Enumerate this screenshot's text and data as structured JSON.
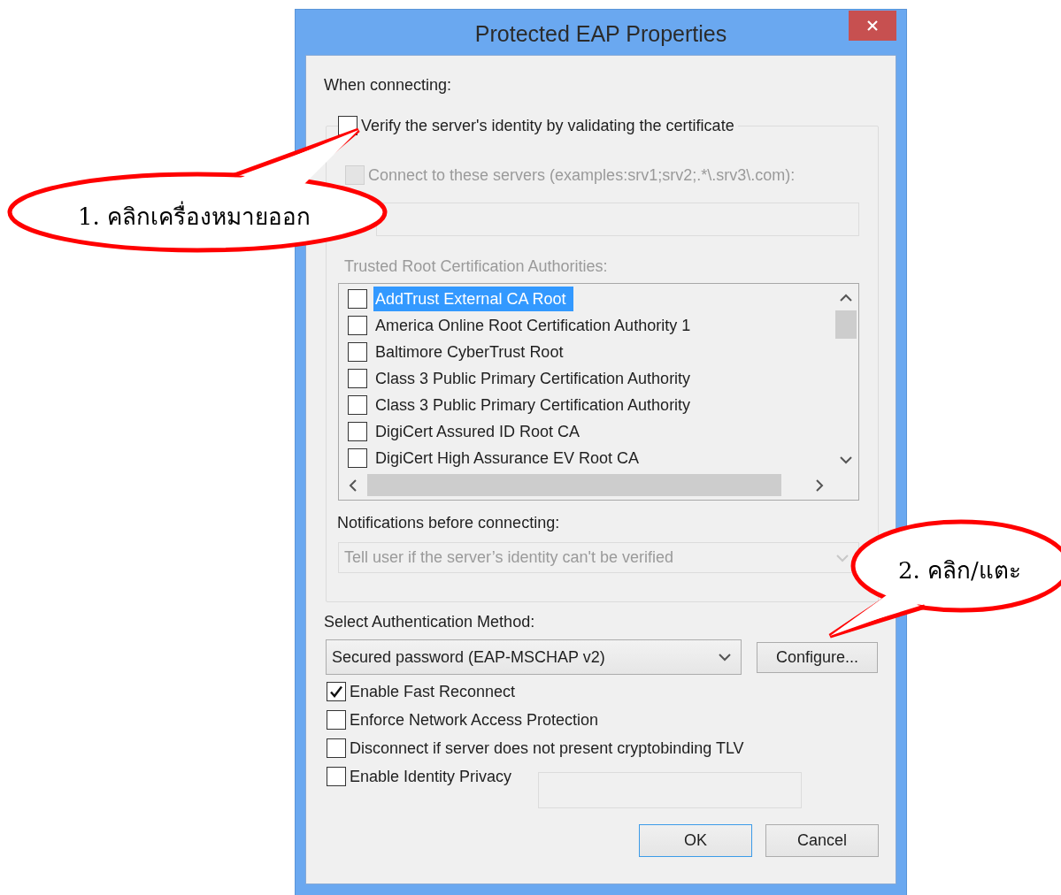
{
  "window": {
    "title": "Protected EAP Properties"
  },
  "when_connecting_label": "When connecting:",
  "verify_certificate": {
    "label": "Verify the server's identity by validating the certificate",
    "checked": false
  },
  "connect_servers": {
    "label": "Connect to these servers (examples:srv1;srv2;.*\\.srv3\\.com):",
    "checked": false,
    "disabled": true
  },
  "trusted_roots": {
    "label": "Trusted Root Certification Authorities:",
    "disabled": true,
    "items": [
      {
        "label": "AddTrust External CA Root",
        "checked": false,
        "selected": true
      },
      {
        "label": "America Online Root Certification Authority 1",
        "checked": false,
        "selected": false
      },
      {
        "label": "Baltimore CyberTrust Root",
        "checked": false,
        "selected": false
      },
      {
        "label": "Class 3 Public Primary Certification Authority",
        "checked": false,
        "selected": false
      },
      {
        "label": "Class 3 Public Primary Certification Authority",
        "checked": false,
        "selected": false
      },
      {
        "label": "DigiCert Assured ID Root CA",
        "checked": false,
        "selected": false
      },
      {
        "label": "DigiCert High Assurance EV Root CA",
        "checked": false,
        "selected": false
      }
    ]
  },
  "notifications": {
    "label": "Notifications before connecting:",
    "value": "Tell user if the server’s identity can't be verified",
    "disabled": true
  },
  "authentication": {
    "label": "Select Authentication Method:",
    "value": "Secured password (EAP-MSCHAP v2)",
    "configure_button": "Configure..."
  },
  "options": [
    {
      "kind": "checkbox",
      "label": "Enable Fast Reconnect",
      "checked": true
    },
    {
      "kind": "checkbox",
      "label": "Enforce Network Access Protection",
      "checked": false
    },
    {
      "kind": "checkbox",
      "label": "Disconnect if server does not present cryptobinding TLV",
      "checked": false
    },
    {
      "kind": "checkbox_field",
      "label": "Enable Identity Privacy",
      "checked": false
    }
  ],
  "buttons": [
    {
      "label": "OK",
      "default": true
    },
    {
      "label": "Cancel",
      "default": false
    }
  ],
  "callouts": [
    {
      "text": "1. คลิกเครื่องหมายออก"
    },
    {
      "text": "2. คลิก/แตะ"
    }
  ]
}
